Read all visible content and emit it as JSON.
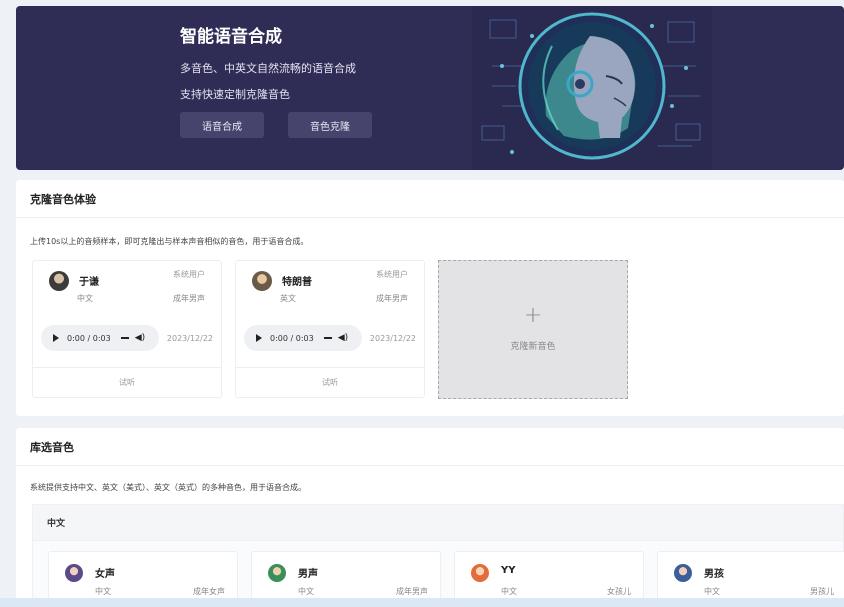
{
  "colors": {
    "banner": "#2f2c55",
    "accent": "#3aa7c8",
    "panel": "#ffffff",
    "page": "#eef1f6"
  },
  "hero": {
    "title": "智能语音合成",
    "subtitle": "多音色、中英文自然流畅的语音合成",
    "subtitle2": "支持快速定制克隆音色",
    "btn_tts": "语音合成",
    "btn_clone": "音色克隆",
    "art_icon": "ai-robot-head-illustration"
  },
  "clone_section": {
    "title": "克隆音色体验",
    "desc": "上传10s以上的音频样本，即可克隆出与样本声音相似的音色，用于语音合成。",
    "cards": [
      {
        "name": "于谦",
        "tag": "系统用户",
        "lang": "中文",
        "gender": "成年男声",
        "time": "0:00 / 0:03",
        "date": "2023/12/22",
        "action": "试听"
      },
      {
        "name": "特朗普",
        "tag": "系统用户",
        "lang": "英文",
        "gender": "成年男声",
        "time": "0:00 / 0:03",
        "date": "2023/12/22",
        "action": "试听"
      }
    ],
    "new_label": "克隆新音色",
    "new_icon": "plus-icon"
  },
  "library": {
    "title": "库选音色",
    "desc": "系统提供支持中文、英文（美式）、英文（英式）的多种音色，用于语音合成。",
    "group": "中文",
    "voices": [
      {
        "name": "女声",
        "lang": "中文",
        "gender": "成年女声",
        "color": "#5b4a8a"
      },
      {
        "name": "男声",
        "lang": "中文",
        "gender": "成年男声",
        "color": "#3a8f5a"
      },
      {
        "name": "YY",
        "lang": "中文",
        "gender": "女孩儿",
        "color": "#e56b3c"
      },
      {
        "name": "男孩",
        "lang": "中文",
        "gender": "男孩儿",
        "color": "#3b5f9a"
      }
    ]
  }
}
